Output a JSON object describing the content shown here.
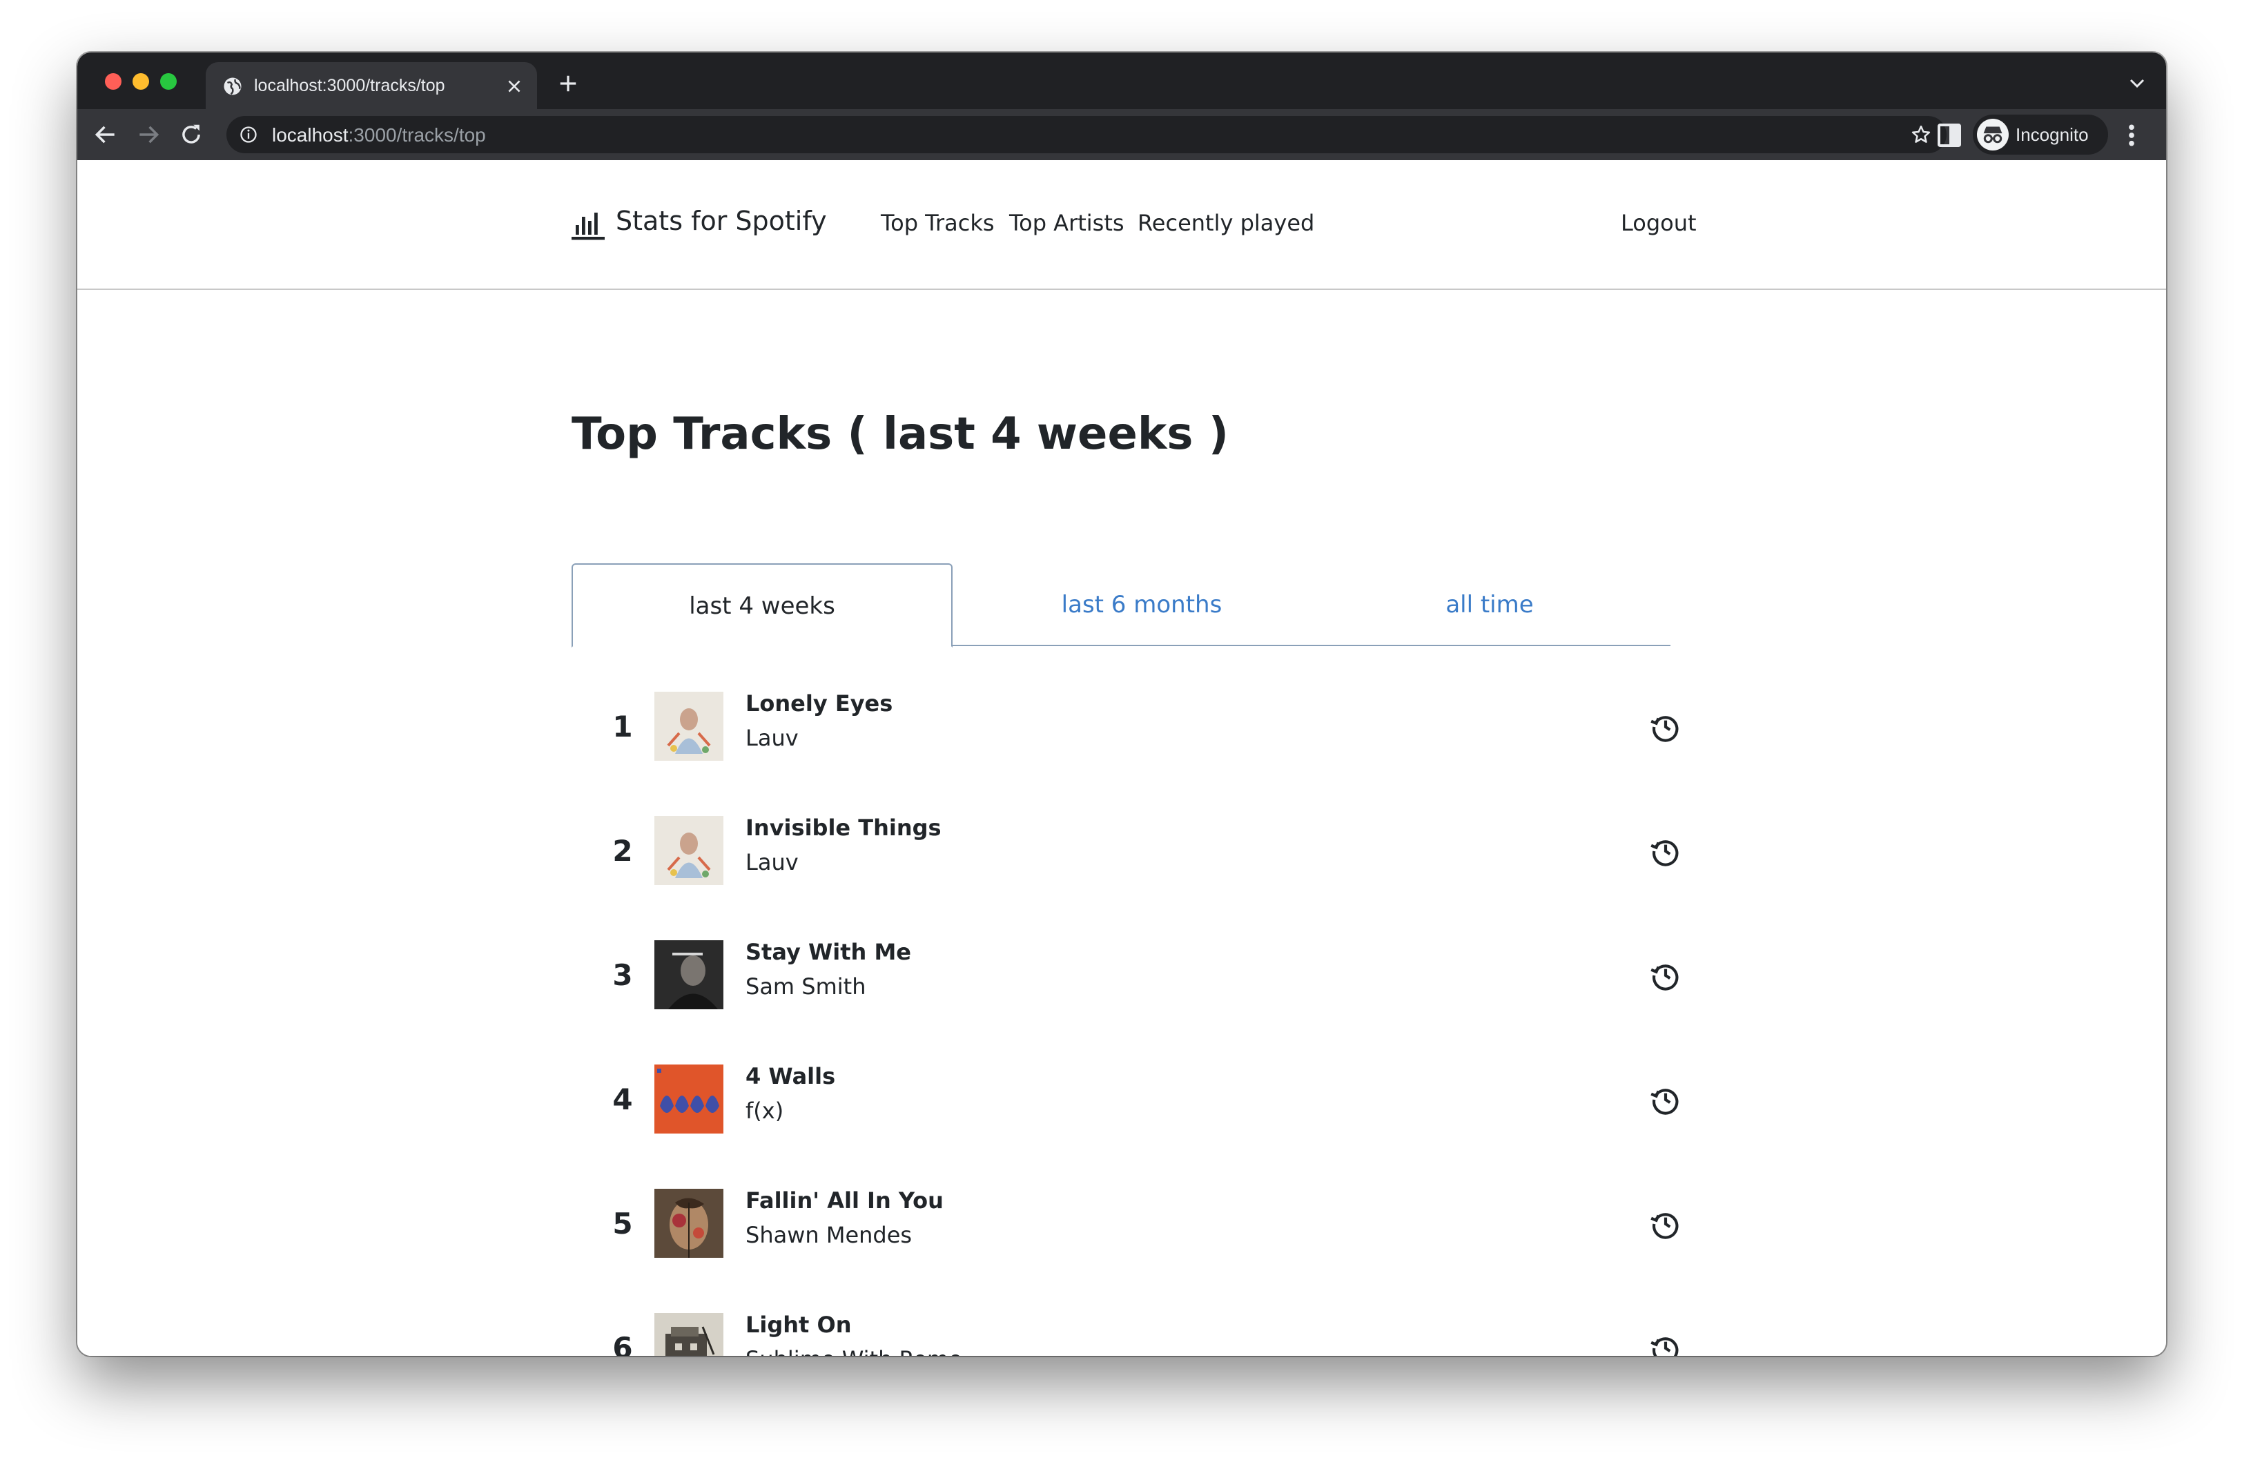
{
  "browser": {
    "tab_title": "localhost:3000/tracks/top",
    "url_host": "localhost",
    "url_path": ":3000/tracks/top",
    "profile_label": "Incognito"
  },
  "navbar": {
    "brand": "Stats for Spotify",
    "links": [
      "Top Tracks",
      "Top Artists",
      "Recently played"
    ],
    "logout": "Logout"
  },
  "heading": "Top Tracks ( last 4 weeks )",
  "period_tabs": [
    {
      "label": "last 4 weeks",
      "active": true
    },
    {
      "label": "last 6 months",
      "active": false
    },
    {
      "label": "all time",
      "active": false
    }
  ],
  "tracks": [
    {
      "rank": "1",
      "title": "Lonely Eyes",
      "artist": "Lauv",
      "cover_color": "#e9e4dc",
      "icon": "history-icon"
    },
    {
      "rank": "2",
      "title": "Invisible Things",
      "artist": "Lauv",
      "cover_color": "#e9e4dc",
      "icon": "history-icon"
    },
    {
      "rank": "3",
      "title": "Stay With Me",
      "artist": "Sam Smith",
      "cover_color": "#2a2a2a",
      "icon": "history-icon"
    },
    {
      "rank": "4",
      "title": "4 Walls",
      "artist": "f(x)",
      "cover_color": "#e0552a",
      "icon": "history-icon"
    },
    {
      "rank": "5",
      "title": "Fallin' All In You",
      "artist": "Shawn Mendes",
      "cover_color": "#6b5644",
      "icon": "history-icon"
    },
    {
      "rank": "6",
      "title": "Light On",
      "artist": "Sublime With Rome",
      "cover_color": "#b8b4aa",
      "icon": "history-icon"
    }
  ],
  "colors": {
    "link": "#3a7bc8",
    "text": "#212529",
    "chrome_dark": "#202124",
    "chrome_toolbar": "#35363a"
  }
}
